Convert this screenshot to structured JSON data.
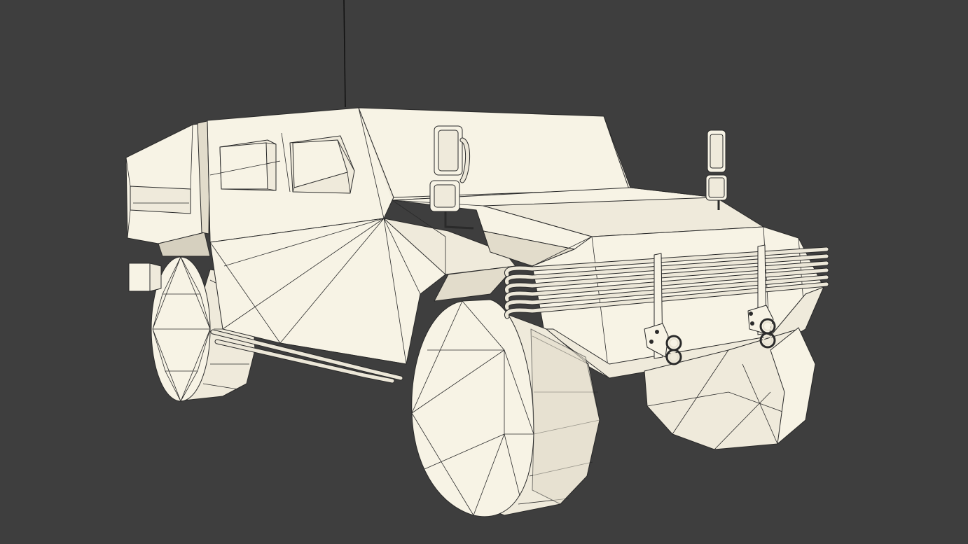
{
  "viewport": {
    "background_color": "#3e3e3e",
    "model_color": "#f7f3e5",
    "wire_color": "#2a2a2a"
  }
}
